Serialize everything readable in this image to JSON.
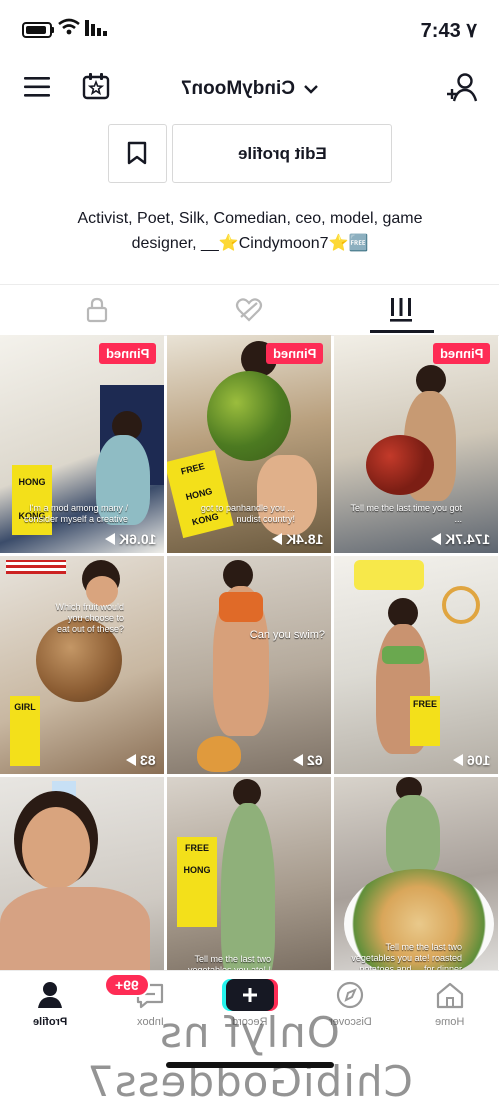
{
  "status_bar": {
    "time": "7:43 ٧"
  },
  "header": {
    "username": "CindyMoon7",
    "menu_icon": "hamburger-menu-icon",
    "calendar_icon": "calendar-star-icon",
    "add_user_icon": "add-user-icon"
  },
  "profile": {
    "edit_profile_label": "Edit profile",
    "bookmark_icon": "bookmark-icon",
    "bio_line_1": "Activist, Poet, Silk, Comedian, ceo, model, game",
    "bio_line_2": "designer, __⭐Cindymoon7⭐🆓"
  },
  "tabs": [
    {
      "icon": "lock-icon",
      "active": false
    },
    {
      "icon": "liked-heart-icon",
      "active": false
    },
    {
      "icon": "grid-icon",
      "active": true
    }
  ],
  "videos": [
    {
      "pinned": "Pinned",
      "views": "10.6K",
      "caption": "I'm a mod among many / consider myself a creative"
    },
    {
      "pinned": "Pinned",
      "views": "18.4K",
      "caption": "got to panhandle you ... nudist country!"
    },
    {
      "pinned": "Pinned",
      "views": "174.7K",
      "caption": "Tell me the last time you got ..."
    },
    {
      "pinned": "",
      "views": "83",
      "caption": "Which fruit would you choose to eat out of these?"
    },
    {
      "pinned": "",
      "views": "62",
      "caption": "Can you swim?"
    },
    {
      "pinned": "",
      "views": "106",
      "caption": ""
    },
    {
      "pinned": "",
      "views": "",
      "caption": ""
    },
    {
      "pinned": "",
      "views": "",
      "caption": "Tell me the last two vegetables you ate! I had potatoes and"
    },
    {
      "pinned": "",
      "views": "",
      "caption": "Tell me the last two vegetables you ate! roasted potatoes and ... for dinner"
    }
  ],
  "bottom_nav": {
    "items": [
      {
        "label": "Home",
        "icon": "home-icon"
      },
      {
        "label": "Discover",
        "icon": "compass-icon"
      },
      {
        "label": "Record",
        "icon": "plus-icon"
      },
      {
        "label": "Inbox",
        "icon": "inbox-icon"
      },
      {
        "label": "Profile",
        "icon": "profile-icon"
      }
    ],
    "inbox_badge": "99+"
  },
  "watermark": "Onlyf ns ChibiGoddess7",
  "colors": {
    "accent": "#fe2c55",
    "text": "#161823",
    "tab_active": "#161823"
  }
}
